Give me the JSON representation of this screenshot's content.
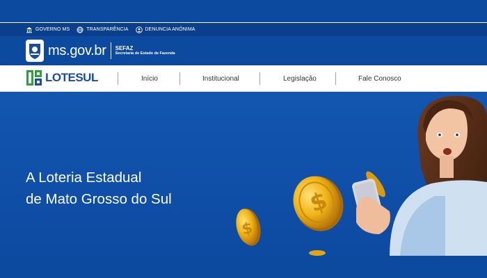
{
  "gov_bar": {
    "links": [
      {
        "label": "GOVERNO MS",
        "icon": "building-icon"
      },
      {
        "label": "TRANSPARÊNCIA",
        "icon": "globe-icon"
      },
      {
        "label": "DENUNCIA ANÔNIMA",
        "icon": "user-icon"
      }
    ]
  },
  "brand": {
    "site_name": "ms.gov.br",
    "dept_title": "SEFAZ",
    "dept_subtitle": "Secretaria de Estado de Fazenda"
  },
  "nav": {
    "logo_text": "LOTESUL",
    "items": [
      "Início",
      "Institucional",
      "Legislação",
      "Fale Conosco"
    ]
  },
  "hero": {
    "title_line1": "A Loteria Estadual",
    "title_line2": "de Mato Grosso do Sul"
  },
  "colors": {
    "primary_blue": "#0c4aa0",
    "logo_green": "#2e9e3e",
    "logo_blue": "#1a4d9e",
    "coin_gold": "#f1b418"
  }
}
